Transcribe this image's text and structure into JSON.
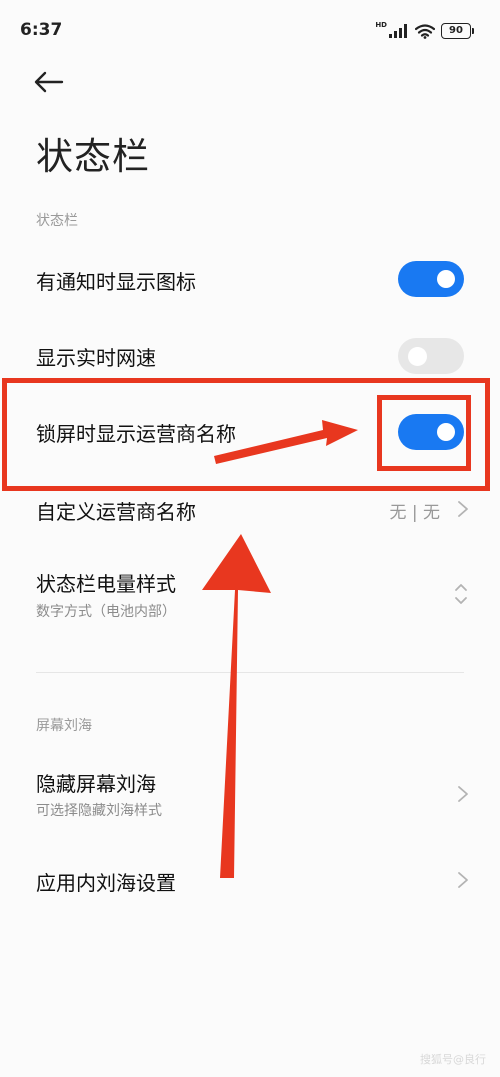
{
  "status_bar": {
    "time": "6:37",
    "network": "HD",
    "battery": "90"
  },
  "page": {
    "title": "状态栏"
  },
  "sections": {
    "status_bar_label": "状态栏",
    "notch_label": "屏幕刘海"
  },
  "items": {
    "show_notification_icons": {
      "label": "有通知时显示图标",
      "enabled": true
    },
    "show_network_speed": {
      "label": "显示实时网速",
      "enabled": false
    },
    "show_carrier_lockscreen": {
      "label": "锁屏时显示运营商名称",
      "enabled": true
    },
    "custom_carrier_name": {
      "label": "自定义运营商名称",
      "value": "无 | 无"
    },
    "battery_style": {
      "label": "状态栏电量样式",
      "sub": "数字方式（电池内部）"
    },
    "hide_notch": {
      "label": "隐藏屏幕刘海",
      "sub": "可选择隐藏刘海样式"
    },
    "in_app_notch": {
      "label": "应用内刘海设置"
    }
  },
  "watermark": "搜狐号@良行",
  "colors": {
    "accent": "#1979f2",
    "annotation": "#e8371f"
  },
  "icons": [
    "signal-icon",
    "wifi-icon",
    "battery-icon",
    "back-arrow-icon",
    "chevron-right-icon",
    "updown-chevron-icon"
  ]
}
